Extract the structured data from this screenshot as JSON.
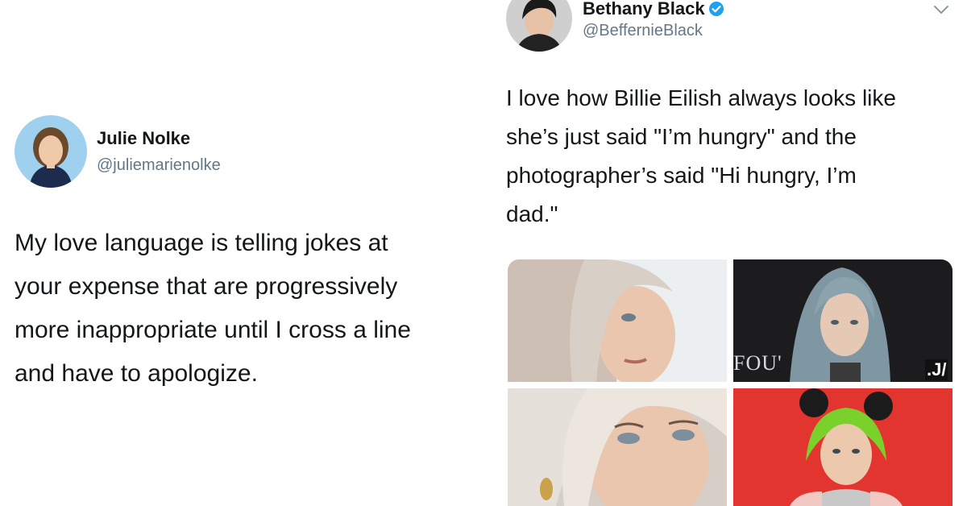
{
  "colors": {
    "text": "#14171a",
    "secondary": "#657786",
    "verified": "#1da1f2",
    "photo_red_bg": "#e2352f"
  },
  "tweet_left": {
    "display_name": "Julie Nolke",
    "handle": "@juliemarienolke",
    "text_lines": [
      "My love language is telling jokes at",
      "your expense that are progressively",
      "more inappropriate until I cross a line",
      "and have to apologize."
    ]
  },
  "tweet_right": {
    "display_name": "Bethany Black",
    "handle": "@BeffernieBlack",
    "verified": true,
    "text_lines": [
      "I love how Billie Eilish always looks like",
      "she’s just said \"I’m hungry\" and the",
      "photographer’s said \"Hi hungry, I’m",
      "dad.\""
    ],
    "photo_overlay_text": [
      "FOU'",
      ".J/"
    ],
    "icons": [
      "verified-badge-icon",
      "chevron-down-icon"
    ]
  }
}
